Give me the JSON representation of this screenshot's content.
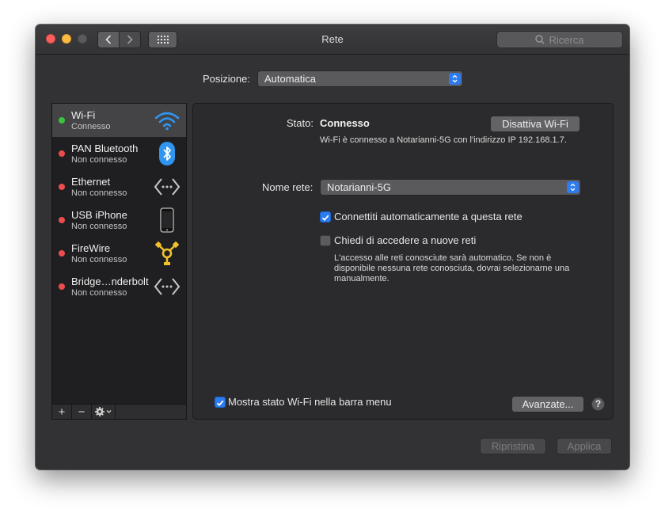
{
  "window": {
    "title": "Rete",
    "search_placeholder": "Ricerca"
  },
  "location": {
    "label": "Posizione:",
    "value": "Automatica"
  },
  "services": [
    {
      "name": "Wi-Fi",
      "status": "Connesso",
      "icon": "wifi-icon",
      "status_color": "#38c53d"
    },
    {
      "name": "PAN Bluetooth",
      "status": "Non connesso",
      "icon": "bluetooth-icon",
      "status_color": "#ec4d4b"
    },
    {
      "name": "Ethernet",
      "status": "Non connesso",
      "icon": "ethernet-icon",
      "status_color": "#ec4d4b"
    },
    {
      "name": "USB iPhone",
      "status": "Non connesso",
      "icon": "iphone-icon",
      "status_color": "#ec4d4b"
    },
    {
      "name": "FireWire",
      "status": "Non connesso",
      "icon": "firewire-icon",
      "status_color": "#ec4d4b"
    },
    {
      "name": "Bridge…nderbolt",
      "status": "Non connesso",
      "icon": "thunderbolt-bridge-icon",
      "status_color": "#ec4d4b"
    }
  ],
  "sidebar_tools": {
    "add": "+",
    "remove": "−"
  },
  "detail": {
    "status_label": "Stato:",
    "status_value": "Connesso",
    "toggle_button": "Disattiva Wi-Fi",
    "status_description": "Wi-Fi è connesso a Notarianni-5G con l'indirizzo IP 192.168.1.7.",
    "network_label": "Nome rete:",
    "network_value": "Notarianni-5G",
    "auto_join": {
      "label": "Connettiti automaticamente a questa rete",
      "checked": true
    },
    "ask_join": {
      "label": "Chiedi di accedere a nuove reti",
      "checked": false
    },
    "ask_join_description": [
      "L'accesso alle reti conosciute sarà automatico. Se non è",
      "disponibile nessuna rete conosciuta, dovrai selezionarne una",
      "manualmente."
    ],
    "show_menu": {
      "label": "Mostra stato Wi-Fi nella barra menu",
      "checked": true
    },
    "advanced_button": "Avanzate...",
    "help_button": "?"
  },
  "footer": {
    "revert_button": "Ripristina",
    "apply_button": "Applica"
  },
  "colors": {
    "accent": "#2c7bf0",
    "connected": "#38c53d",
    "disconnected": "#ec4d4b"
  }
}
